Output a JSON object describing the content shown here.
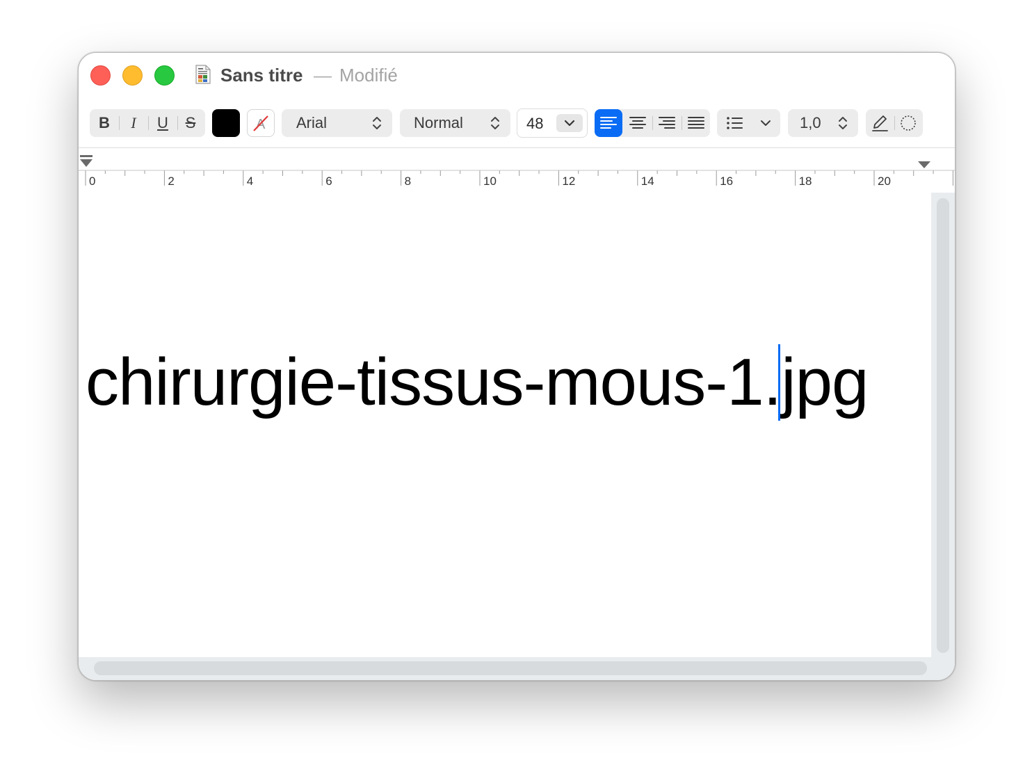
{
  "window": {
    "title": "Sans titre",
    "separator": "—",
    "status": "Modifié"
  },
  "toolbar": {
    "bold_label": "B",
    "italic_label": "I",
    "underline_label": "U",
    "strikethrough_label": "S",
    "text_color": "#000000",
    "font_family": "Arial",
    "font_style": "Normal",
    "font_size": "48",
    "alignment_selected": "left",
    "line_spacing": "1,0",
    "accent_color": "#0a6cf5"
  },
  "ruler": {
    "labels": [
      "0",
      "2",
      "4",
      "6",
      "8",
      "10",
      "12",
      "14",
      "16",
      "18",
      "20"
    ]
  },
  "document": {
    "text_before_caret": "chirurgie-tissus-mous-1",
    "text_after_caret": ".jpg"
  }
}
